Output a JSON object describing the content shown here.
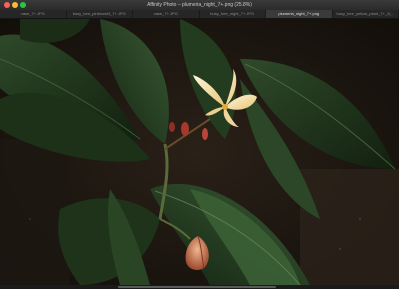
{
  "window": {
    "title": "Affinity Photo – plumeria_night_7+.png (25.8%)"
  },
  "tabs": [
    {
      "label": "vase_7+.JPG",
      "active": false
    },
    {
      "label": "busy_bee_pinkbowl3_7+.JPG",
      "active": false
    },
    {
      "label": "vase_7+.JPG",
      "active": false
    },
    {
      "label": "busy_bee_night_7+.JPG",
      "active": false
    },
    {
      "label": "plumeria_night_7+.png",
      "active": true
    },
    {
      "label": "busy_bee_yellow_plant_7+_2(...",
      "active": false
    }
  ]
}
